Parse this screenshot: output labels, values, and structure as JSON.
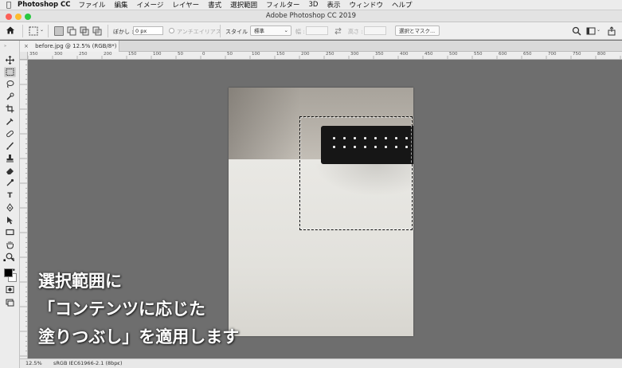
{
  "menubar": {
    "app_name": "Photoshop CC",
    "items": [
      "ファイル",
      "編集",
      "イメージ",
      "レイヤー",
      "書式",
      "選択範囲",
      "フィルター",
      "3D",
      "表示",
      "ウィンドウ",
      "ヘルプ"
    ]
  },
  "window": {
    "title": "Adobe Photoshop CC 2019"
  },
  "options_bar": {
    "feather_label": "ぼかし :",
    "feather_value": "0 px",
    "antialias_label": "アンチエイリアス",
    "style_label": "スタイル :",
    "style_value": "標準",
    "width_label": "幅 :",
    "height_label": "高さ :",
    "select_mask_label": "選択とマスク..."
  },
  "document_tab": {
    "label": "before.jpg @ 12.5% (RGB/8*)",
    "close": "×"
  },
  "ruler": {
    "h_ticks": [
      "350",
      "300",
      "250",
      "200",
      "150",
      "100",
      "50",
      "0",
      "50",
      "100",
      "150",
      "200",
      "250",
      "300",
      "350",
      "400",
      "450",
      "500",
      "550",
      "600",
      "650",
      "700",
      "750",
      "800"
    ]
  },
  "caption": {
    "line1": "選択範囲に",
    "line2": "「コンテンツに応じた",
    "line3": "塗りつぶし」を適用します"
  },
  "status_bar": {
    "zoom": "12.5%",
    "profile": "sRGB IEC61966-2.1 (8bpc)",
    "arrow": "›"
  },
  "colors": {
    "foreground": "#000000",
    "background": "#ffffff",
    "workspace": "#6e6e6e"
  }
}
